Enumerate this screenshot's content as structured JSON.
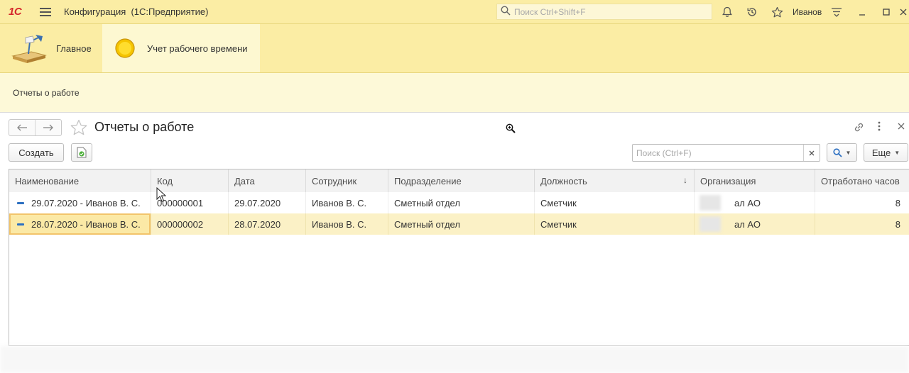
{
  "titlebar": {
    "logo": "1С",
    "title": "Конфигурация  (1С:Предприятие)",
    "search_placeholder": "Поиск Ctrl+Shift+F",
    "user": "Иванов"
  },
  "sections": [
    {
      "label": "Главное",
      "icon": "desk-lamp-icon"
    },
    {
      "label": "Учет рабочего времени",
      "icon": "sun-icon"
    }
  ],
  "function_panel": {
    "link": "Отчеты о работе"
  },
  "form": {
    "title": "Отчеты о работе",
    "create_label": "Создать",
    "search_placeholder": "Поиск (Ctrl+F)",
    "more_label": "Еще"
  },
  "table": {
    "columns": [
      "Наименование",
      "Код",
      "Дата",
      "Сотрудник",
      "Подразделение",
      "Должность",
      "Организация",
      "Отработано часов"
    ],
    "sort_indicator": "↓",
    "rows": [
      {
        "name": "29.07.2020 - Иванов В. С.",
        "code": "000000001",
        "date": "29.07.2020",
        "employee": "Иванов В. С.",
        "department": "Сметный отдел",
        "position": "Сметчик",
        "organization": "ал АО",
        "hours": "8"
      },
      {
        "name": "28.07.2020 - Иванов В. С.",
        "code": "000000002",
        "date": "28.07.2020",
        "employee": "Иванов В. С.",
        "department": "Сметный отдел",
        "position": "Сметчик",
        "organization": "ал АО",
        "hours": "8"
      }
    ]
  },
  "colors": {
    "panel_yellow": "#fbeda4",
    "selected_row": "#fbf1c6",
    "accent_red": "#d4262b"
  }
}
